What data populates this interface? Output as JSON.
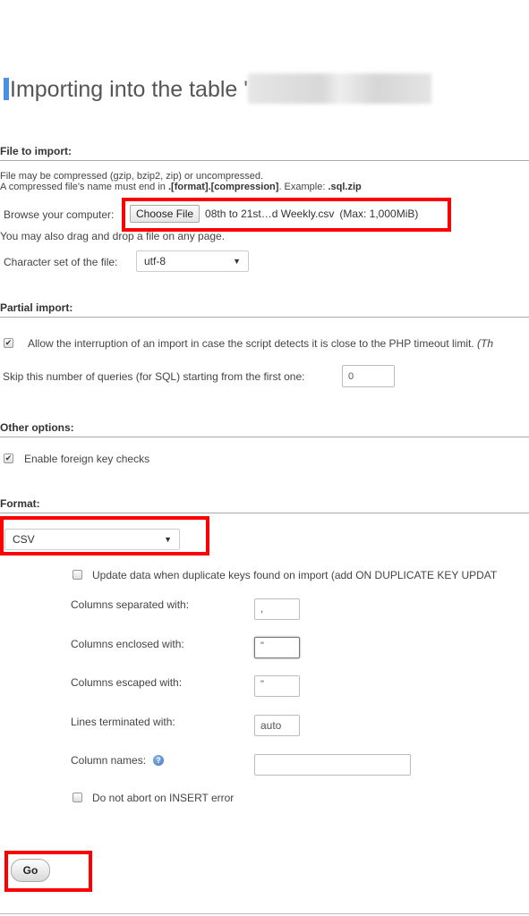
{
  "page": {
    "title": "Importing into the table '",
    "title_redacted": true
  },
  "file_to_import": {
    "heading": "File to import:",
    "line1": "File may be compressed (gzip, bzip2, zip) or uncompressed.",
    "line2_prefix": "A compressed file's name must end in ",
    "line2_format": ".[format].[compression]",
    "line2_mid": ". Example: ",
    "line2_example": ".sql.zip",
    "browse_label": "Browse your computer:",
    "choose_file_button": "Choose File",
    "chosen_file": "08th to 21st…d Weekly.csv",
    "max_size": "(Max: 1,000MiB)",
    "drag_hint": "You may also drag and drop a file on any page.",
    "charset_label": "Character set of the file:",
    "charset_value": "utf-8"
  },
  "partial_import": {
    "heading": "Partial import:",
    "allow_interrupt_label": "Allow the interruption of an import in case the script detects it is close to the PHP timeout limit.",
    "allow_interrupt_suffix": "(Th",
    "allow_interrupt_checked": true,
    "skip_label": "Skip this number of queries (for SQL) starting from the first one:",
    "skip_value": "0"
  },
  "other_options": {
    "heading": "Other options:",
    "foreign_key_label": "Enable foreign key checks",
    "foreign_key_checked": true
  },
  "format": {
    "heading": "Format:",
    "selected": "CSV",
    "update_duplicates_label": "Update data when duplicate keys found on import (add ON DUPLICATE KEY UPDAT",
    "update_duplicates_checked": false,
    "fields": [
      {
        "label": "Columns separated with:",
        "value": ","
      },
      {
        "label": "Columns enclosed with:",
        "value": "\""
      },
      {
        "label": "Columns escaped with:",
        "value": "\""
      },
      {
        "label": "Lines terminated with:",
        "value": "auto"
      },
      {
        "label": "Column names:",
        "value": ""
      }
    ],
    "no_abort_label": "Do not abort on INSERT error",
    "no_abort_checked": false
  },
  "actions": {
    "go_button": "Go"
  },
  "annotations": {
    "highlight_color": "#ff0000"
  }
}
